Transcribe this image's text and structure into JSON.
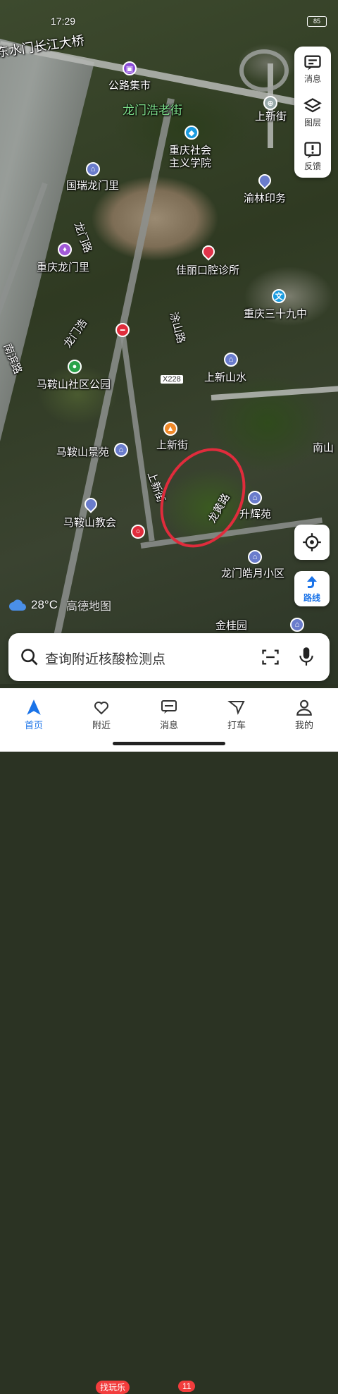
{
  "status_bar": {
    "time": "17:29",
    "battery": "85"
  },
  "map": {
    "labels": [
      {
        "text": "东水门长江大桥"
      },
      {
        "text": "公路集市"
      },
      {
        "text": "龙门浩老街"
      },
      {
        "text": "上新街"
      },
      {
        "text": "重庆社会"
      },
      {
        "text": "主义学院"
      },
      {
        "text": "国瑞龙门里"
      },
      {
        "text": "渝林印务"
      },
      {
        "text": "龙门路"
      },
      {
        "text": "重庆龙门里"
      },
      {
        "text": "佳丽口腔诊所"
      },
      {
        "text": "重庆三十九中"
      },
      {
        "text": "龙门浩"
      },
      {
        "text": "涂山路"
      },
      {
        "text": "南滨路"
      },
      {
        "text": "马鞍山社区公园"
      },
      {
        "text": "上新山水"
      },
      {
        "text": "X228"
      },
      {
        "text": "上新街"
      },
      {
        "text": "马鞍山景苑"
      },
      {
        "text": "南山"
      },
      {
        "text": "上新街"
      },
      {
        "text": "龙黄路"
      },
      {
        "text": "升辉苑"
      },
      {
        "text": "马鞍山教会"
      },
      {
        "text": "龙门皓月小区"
      },
      {
        "text": "金桂园"
      }
    ]
  },
  "side_panel": {
    "messages": "消息",
    "layers": "图层",
    "feedback": "反馈"
  },
  "route_button": "路线",
  "weather": {
    "temp": "28°C",
    "attribution": "高德地图"
  },
  "search": {
    "placeholder": "查询附近核酸检测点"
  },
  "nav": {
    "items": [
      {
        "label": "首页"
      },
      {
        "label": "附近",
        "badge": "找玩乐"
      },
      {
        "label": "消息",
        "badge": "11"
      },
      {
        "label": "打车"
      },
      {
        "label": "我的"
      }
    ]
  },
  "colors": {
    "accent": "#1a73e8",
    "badge": "#f23d3d",
    "annotation": "#e02c3c"
  }
}
